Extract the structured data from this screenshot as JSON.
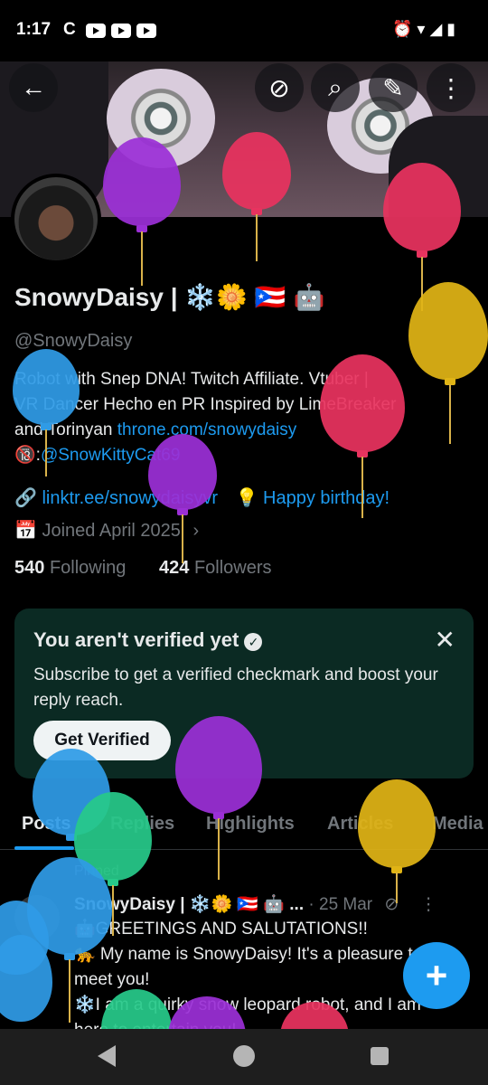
{
  "status_bar": {
    "time": "1:17",
    "app_c": "C",
    "icons_right": "⏰ ▾ ◢ ▮"
  },
  "top_actions": {
    "back": "←",
    "sync": "⊘",
    "search": "⌕",
    "edit": "✎",
    "more": "⋮"
  },
  "profile": {
    "name": "SnowyDaisy | ❄️🌼 🇵🇷 🤖",
    "handle": "@SnowyDaisy",
    "bio_line1": "Robot with Snep DNA!  Twitch Affiliate. Vtuber |",
    "bio_line2": "VR Dancer Hecho en PR  Inspired by LimeBreaker",
    "bio_line3_text": "and Torinyan  ",
    "bio_line3_link": "throne.com/snowydaisy",
    "bio_line4_prefix": "🔞:",
    "bio_line4_link": "@SnowKittyCat69",
    "website": "linktr.ee/snowydaisyvr",
    "birthday": "Happy birthday!",
    "joined": "Joined April 2025",
    "following_count": "540",
    "following_label": "Following",
    "followers_count": "424",
    "followers_label": "Followers"
  },
  "verify_card": {
    "title": "You aren't verified yet",
    "description": "Subscribe to get a verified checkmark and boost your reply reach.",
    "button": "Get Verified",
    "close": "✕"
  },
  "tabs": [
    "Posts",
    "Replies",
    "Highlights",
    "Articles",
    "Media"
  ],
  "post": {
    "pinned": "Pinned",
    "author": "SnowyDaisy | ❄️🌼 🇵🇷 🤖 ...",
    "date": "· 25 Mar",
    "line1": "🤖GREETINGS AND SALUTATIONS!!",
    "line2": "🐆 My name is SnowyDaisy! It's a pleasure to",
    "line3": "meet you!",
    "line4": "❄️I am a quirky snow leopard robot, and I am",
    "line5": "here to entertain you!"
  },
  "fab": "+",
  "colors": {
    "accent": "#1d9bf0",
    "card_bg": "#0b2a23",
    "balloon_purple": "#9b2fd6",
    "balloon_red": "#e8335f",
    "balloon_yellow": "#e0b416",
    "balloon_blue": "#2f9be6",
    "balloon_green": "#27c98a"
  }
}
